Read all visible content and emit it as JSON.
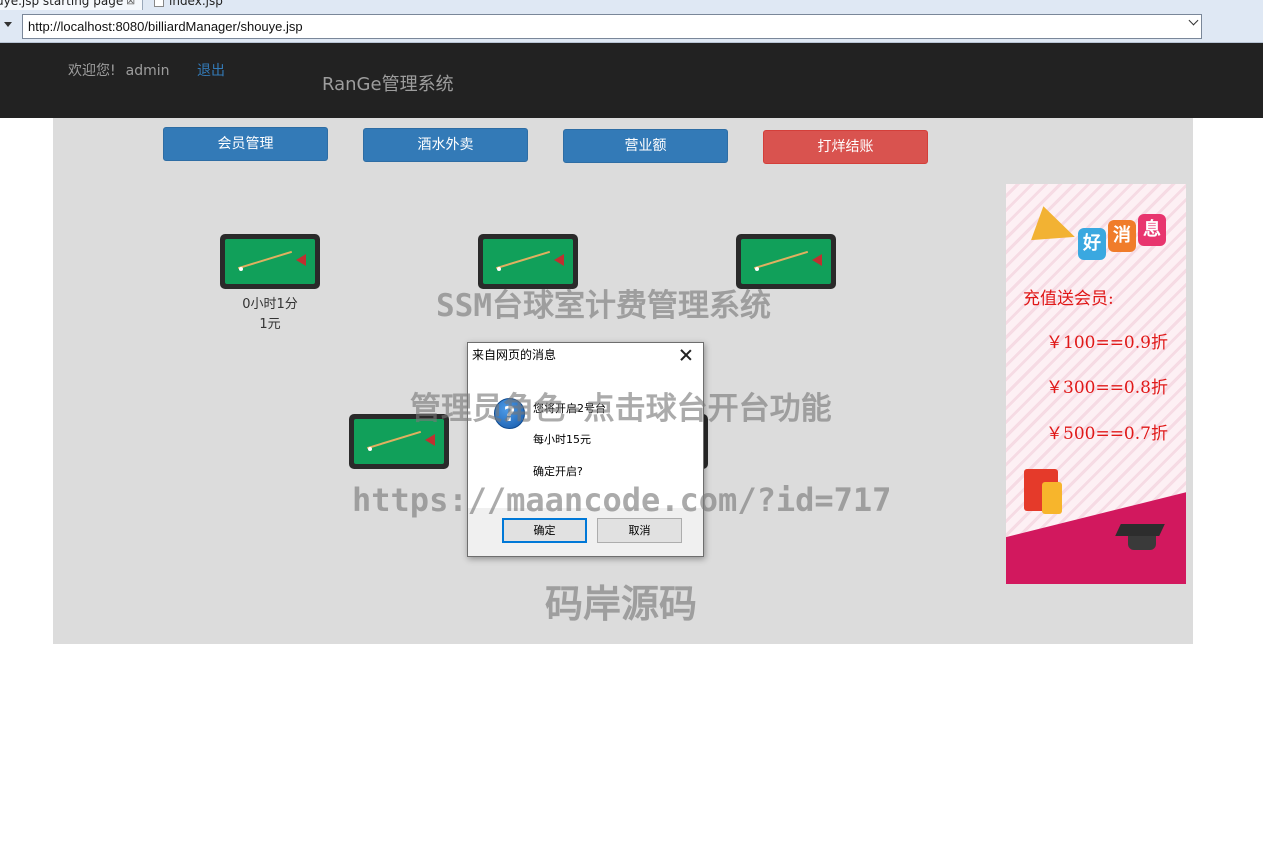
{
  "browser": {
    "tabs": [
      {
        "label": "uye.jsp  starting page",
        "close": "⊠"
      },
      {
        "label": "index.jsp"
      }
    ],
    "url": "http://localhost:8080/billiardManager/shouye.jsp"
  },
  "navbar": {
    "welcome": "欢迎您!",
    "user": "admin",
    "logout": "退出",
    "brand": "RanGe管理系统"
  },
  "buttons": {
    "members": "会员管理",
    "drinks": "酒水外卖",
    "revenue": "营业额",
    "checkout": "打烊结账"
  },
  "tables": [
    {
      "time": "0小时1分",
      "cost": "1元"
    }
  ],
  "ad": {
    "badge_chars": [
      "好",
      "消",
      "息"
    ],
    "title": "充值送会员:",
    "prices": [
      "￥100==0.9折",
      "￥300==0.8折",
      "￥500==0.7折"
    ]
  },
  "watermarks": [
    "SSM台球室计费管理系统",
    "管理员角色-点击球台开台功能",
    "https://maancode.com/?id=717",
    "码岸源码"
  ],
  "dialog": {
    "title": "来自网页的消息",
    "lines": [
      "您将开启2号台",
      "每小时15元",
      "确定开启?"
    ],
    "ok": "确定",
    "cancel": "取消"
  },
  "colors": {
    "navbar_bg": "#222222",
    "primary": "#337ab7",
    "danger": "#d9534f",
    "panel_bg": "#dcdcdc",
    "felt": "#11a05a",
    "ad_text": "#e01818"
  }
}
